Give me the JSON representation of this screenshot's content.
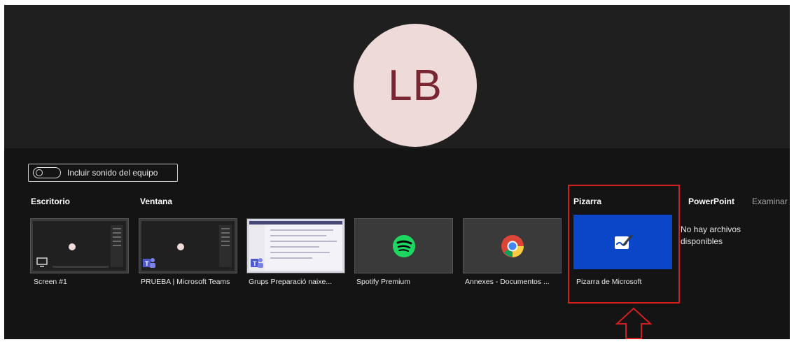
{
  "avatar": {
    "initials": "LB"
  },
  "toggle": {
    "label": "Incluir sonido del equipo"
  },
  "sections": {
    "desktop": "Escritorio",
    "window": "Ventana",
    "whiteboard": "Pizarra",
    "powerpoint": "PowerPoint",
    "browse": "Examinar"
  },
  "thumbnails": [
    {
      "caption": "Screen #1",
      "icon": "monitor-icon"
    },
    {
      "caption": "PRUEBA | Microsoft Teams",
      "icon": "teams-icon"
    },
    {
      "caption": "Grups Preparació naixe...",
      "icon": "teams-icon"
    },
    {
      "caption": "Spotify Premium",
      "icon": "spotify-icon"
    },
    {
      "caption": "Annexes - Documentos ...",
      "icon": "chrome-icon"
    }
  ],
  "whiteboard": {
    "caption": "Pizarra de Microsoft",
    "icon": "whiteboard-icon"
  },
  "powerpoint": {
    "empty_message": "No hay archivos disponibles"
  },
  "colors": {
    "highlight": "#d21f1f",
    "whiteboard_bg": "#0b45c8",
    "spotify": "#1ed760",
    "avatar_bg": "#eedbd9",
    "avatar_text": "#7a2632"
  }
}
